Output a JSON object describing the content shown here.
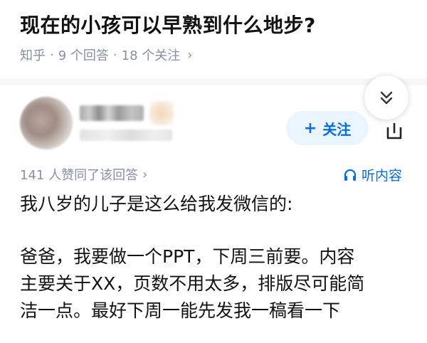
{
  "question": {
    "title": "现在的小孩可以早熟到什么地步?",
    "source": "知乎",
    "dot": "·",
    "answers_count": "9 个回答",
    "followers_count": "18 个关注",
    "chevron": "›"
  },
  "author": {
    "follow_plus": "+",
    "follow_label": "关注"
  },
  "answer": {
    "upvote_text": "141 人赞同了该回答",
    "upvote_chevron": "›",
    "listen_label": "听内容",
    "paragraphs": [
      "我八岁的儿子是这么给我发微信的:",
      "爸爸，我要做一个PPT，下周三前要。内容",
      "主要关于XX，页数不用太多，排版尽可能简",
      "洁一点。最好下周一能先发我一稿看一下"
    ]
  },
  "icons": {
    "collapse": "chevron-double-down-icon",
    "share": "share-icon",
    "headphones": "headphones-icon"
  },
  "colors": {
    "accent": "#056de8",
    "meta": "#8590a6",
    "follow_bg": "#ebf5ff"
  }
}
